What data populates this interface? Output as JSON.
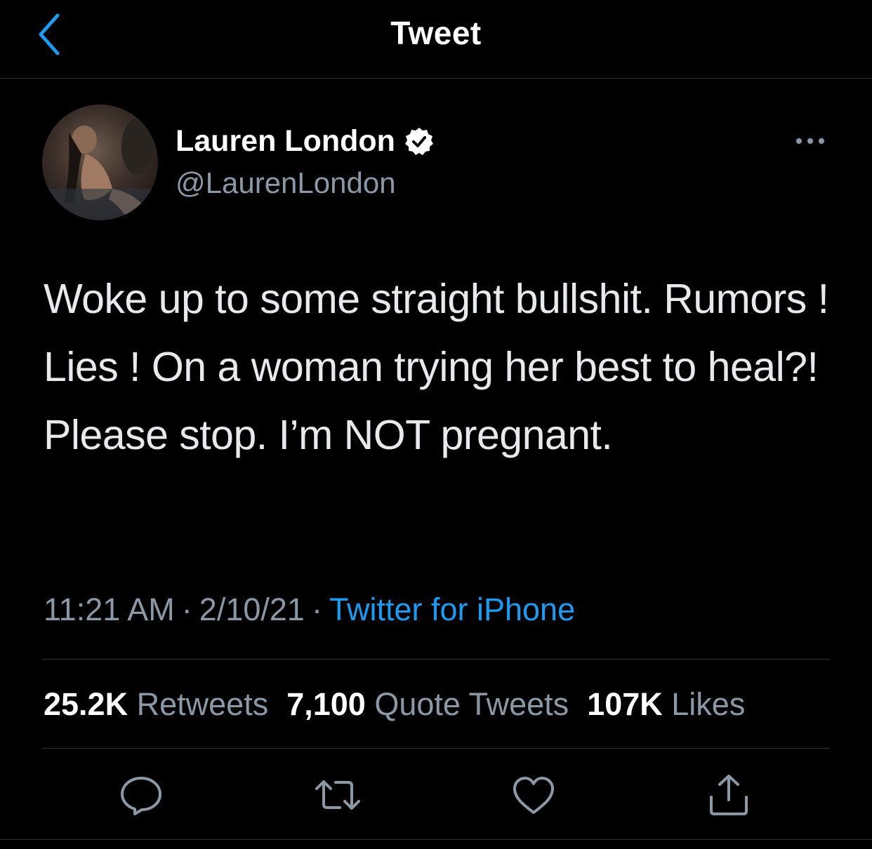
{
  "nav": {
    "title": "Tweet",
    "back_icon": "chevron-left-icon"
  },
  "author": {
    "name": "Lauren London",
    "handle": "@LaurenLondon",
    "verified": true
  },
  "tweet": {
    "text": "Woke up to some straight bullshit. Rumors ! Lies ! On a woman trying her best to heal?! Please stop. I’m NOT pregnant.",
    "time": "11:21 AM",
    "date": "2/10/21",
    "separator": "·",
    "source": "Twitter for iPhone"
  },
  "stats": {
    "retweets_count": "25.2K",
    "retweets_label": "Retweets",
    "quotes_count": "7,100",
    "quotes_label": "Quote Tweets",
    "likes_count": "107K",
    "likes_label": "Likes"
  },
  "actions": [
    "reply-icon",
    "retweet-icon",
    "like-icon",
    "share-icon"
  ],
  "colors": {
    "background": "#000000",
    "text": "#e7e9ea",
    "secondary": "#8b98a5",
    "accent": "#1d9bf0",
    "divider": "#2f3336"
  }
}
